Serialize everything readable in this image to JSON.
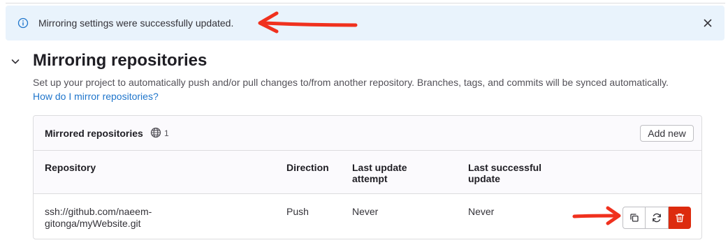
{
  "alert": {
    "message": "Mirroring settings were successfully updated.",
    "icon": "info-icon",
    "close_icon": "close-icon"
  },
  "section": {
    "title": "Mirroring repositories",
    "description": "Set up your project to automatically push and/or pull changes to/from another repository. Branches, tags, and commits will be synced automatically.",
    "help_link": "How do I mirror repositories?"
  },
  "card": {
    "title": "Mirrored repositories",
    "count": "1",
    "add_button": "Add new"
  },
  "table": {
    "headers": {
      "repository": "Repository",
      "direction": "Direction",
      "last_update_attempt": "Last update attempt",
      "last_successful_update": "Last successful update"
    },
    "rows": [
      {
        "repository": "ssh://github.com/naeem-gitonga/myWebsite.git",
        "direction": "Push",
        "last_update_attempt": "Never",
        "last_successful_update": "Never",
        "actions": [
          "copy-icon",
          "retry-icon",
          "trash-icon"
        ]
      }
    ]
  },
  "colors": {
    "alert_bg": "#e9f3fc",
    "link": "#1f75cb",
    "danger": "#dd2b0e",
    "annotation_arrow": "#f0311e"
  }
}
